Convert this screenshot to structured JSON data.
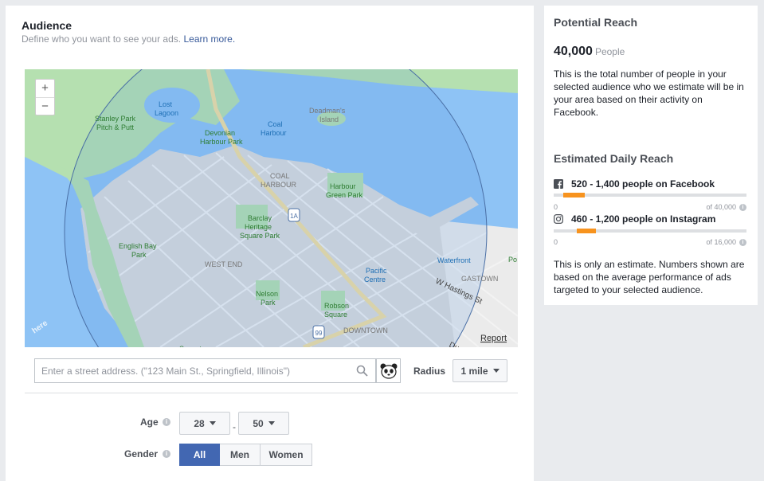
{
  "audience": {
    "title": "Audience",
    "subtitle": "Define who you want to see your ads.",
    "learn_more": "Learn more."
  },
  "map": {
    "zoom_in": "+",
    "zoom_out": "−",
    "labels": {
      "stanley_park": "Stanley Park\nPitch & Putt",
      "lost_lagoon": "Lost\nLagoon",
      "deadmans": "Deadman's\nIsland",
      "devonian": "Devonian\nHarbour Park",
      "coal_harbour_water": "Coal\nHarbour",
      "coal_harbour_area": "COAL\nHARBOUR",
      "harbour_green": "Harbour\nGreen Park",
      "barclay": "Barclay\nHeritage\nSquare Park",
      "english_bay": "English Bay\nPark",
      "west_end": "WEST END",
      "pacific_centre": "Pacific\nCentre",
      "waterfront": "Waterfront",
      "gastown": "GASTOWN",
      "hastings": "W Hastings St",
      "nelson": "Nelson\nPark",
      "robson": "Robson\nSquare",
      "downtown": "DOWNTOWN",
      "sunset": "Sunset",
      "here_logo": "here",
      "report": "Report",
      "highway_1a": "1A",
      "highway_99": "99",
      "po": "Po",
      "du": "Du"
    }
  },
  "address": {
    "placeholder": "Enter a street address. (\"123 Main St., Springfield, Illinois\")"
  },
  "radius": {
    "label": "Radius",
    "value": "1 mile"
  },
  "age": {
    "label": "Age",
    "min": "28",
    "max": "50",
    "separator": "-"
  },
  "gender": {
    "label": "Gender",
    "options": [
      "All",
      "Men",
      "Women"
    ],
    "selected": "All"
  },
  "reach": {
    "title": "Potential Reach",
    "number": "40,000",
    "unit": "People",
    "description": "This is the total number of people in your selected audience who we estimate will be in your area based on their activity on Facebook.",
    "daily_title": "Estimated Daily Reach",
    "facebook": {
      "label": "520 - 1,400 people on Facebook",
      "min": "0",
      "max": "of 40,000",
      "range_low": 0.05,
      "range_high": 0.16
    },
    "instagram": {
      "label": "460 - 1,200 people on Instagram",
      "min": "0",
      "max": "of 16,000",
      "range_low": 0.12,
      "range_high": 0.22
    },
    "note": "This is only an estimate. Numbers shown are based on the average performance of ads targeted to your selected audience."
  },
  "colors": {
    "accent": "#4267b2",
    "bar_fill": "#f7931e",
    "water": "#8ec3f5",
    "park": "#b5e0b0"
  }
}
